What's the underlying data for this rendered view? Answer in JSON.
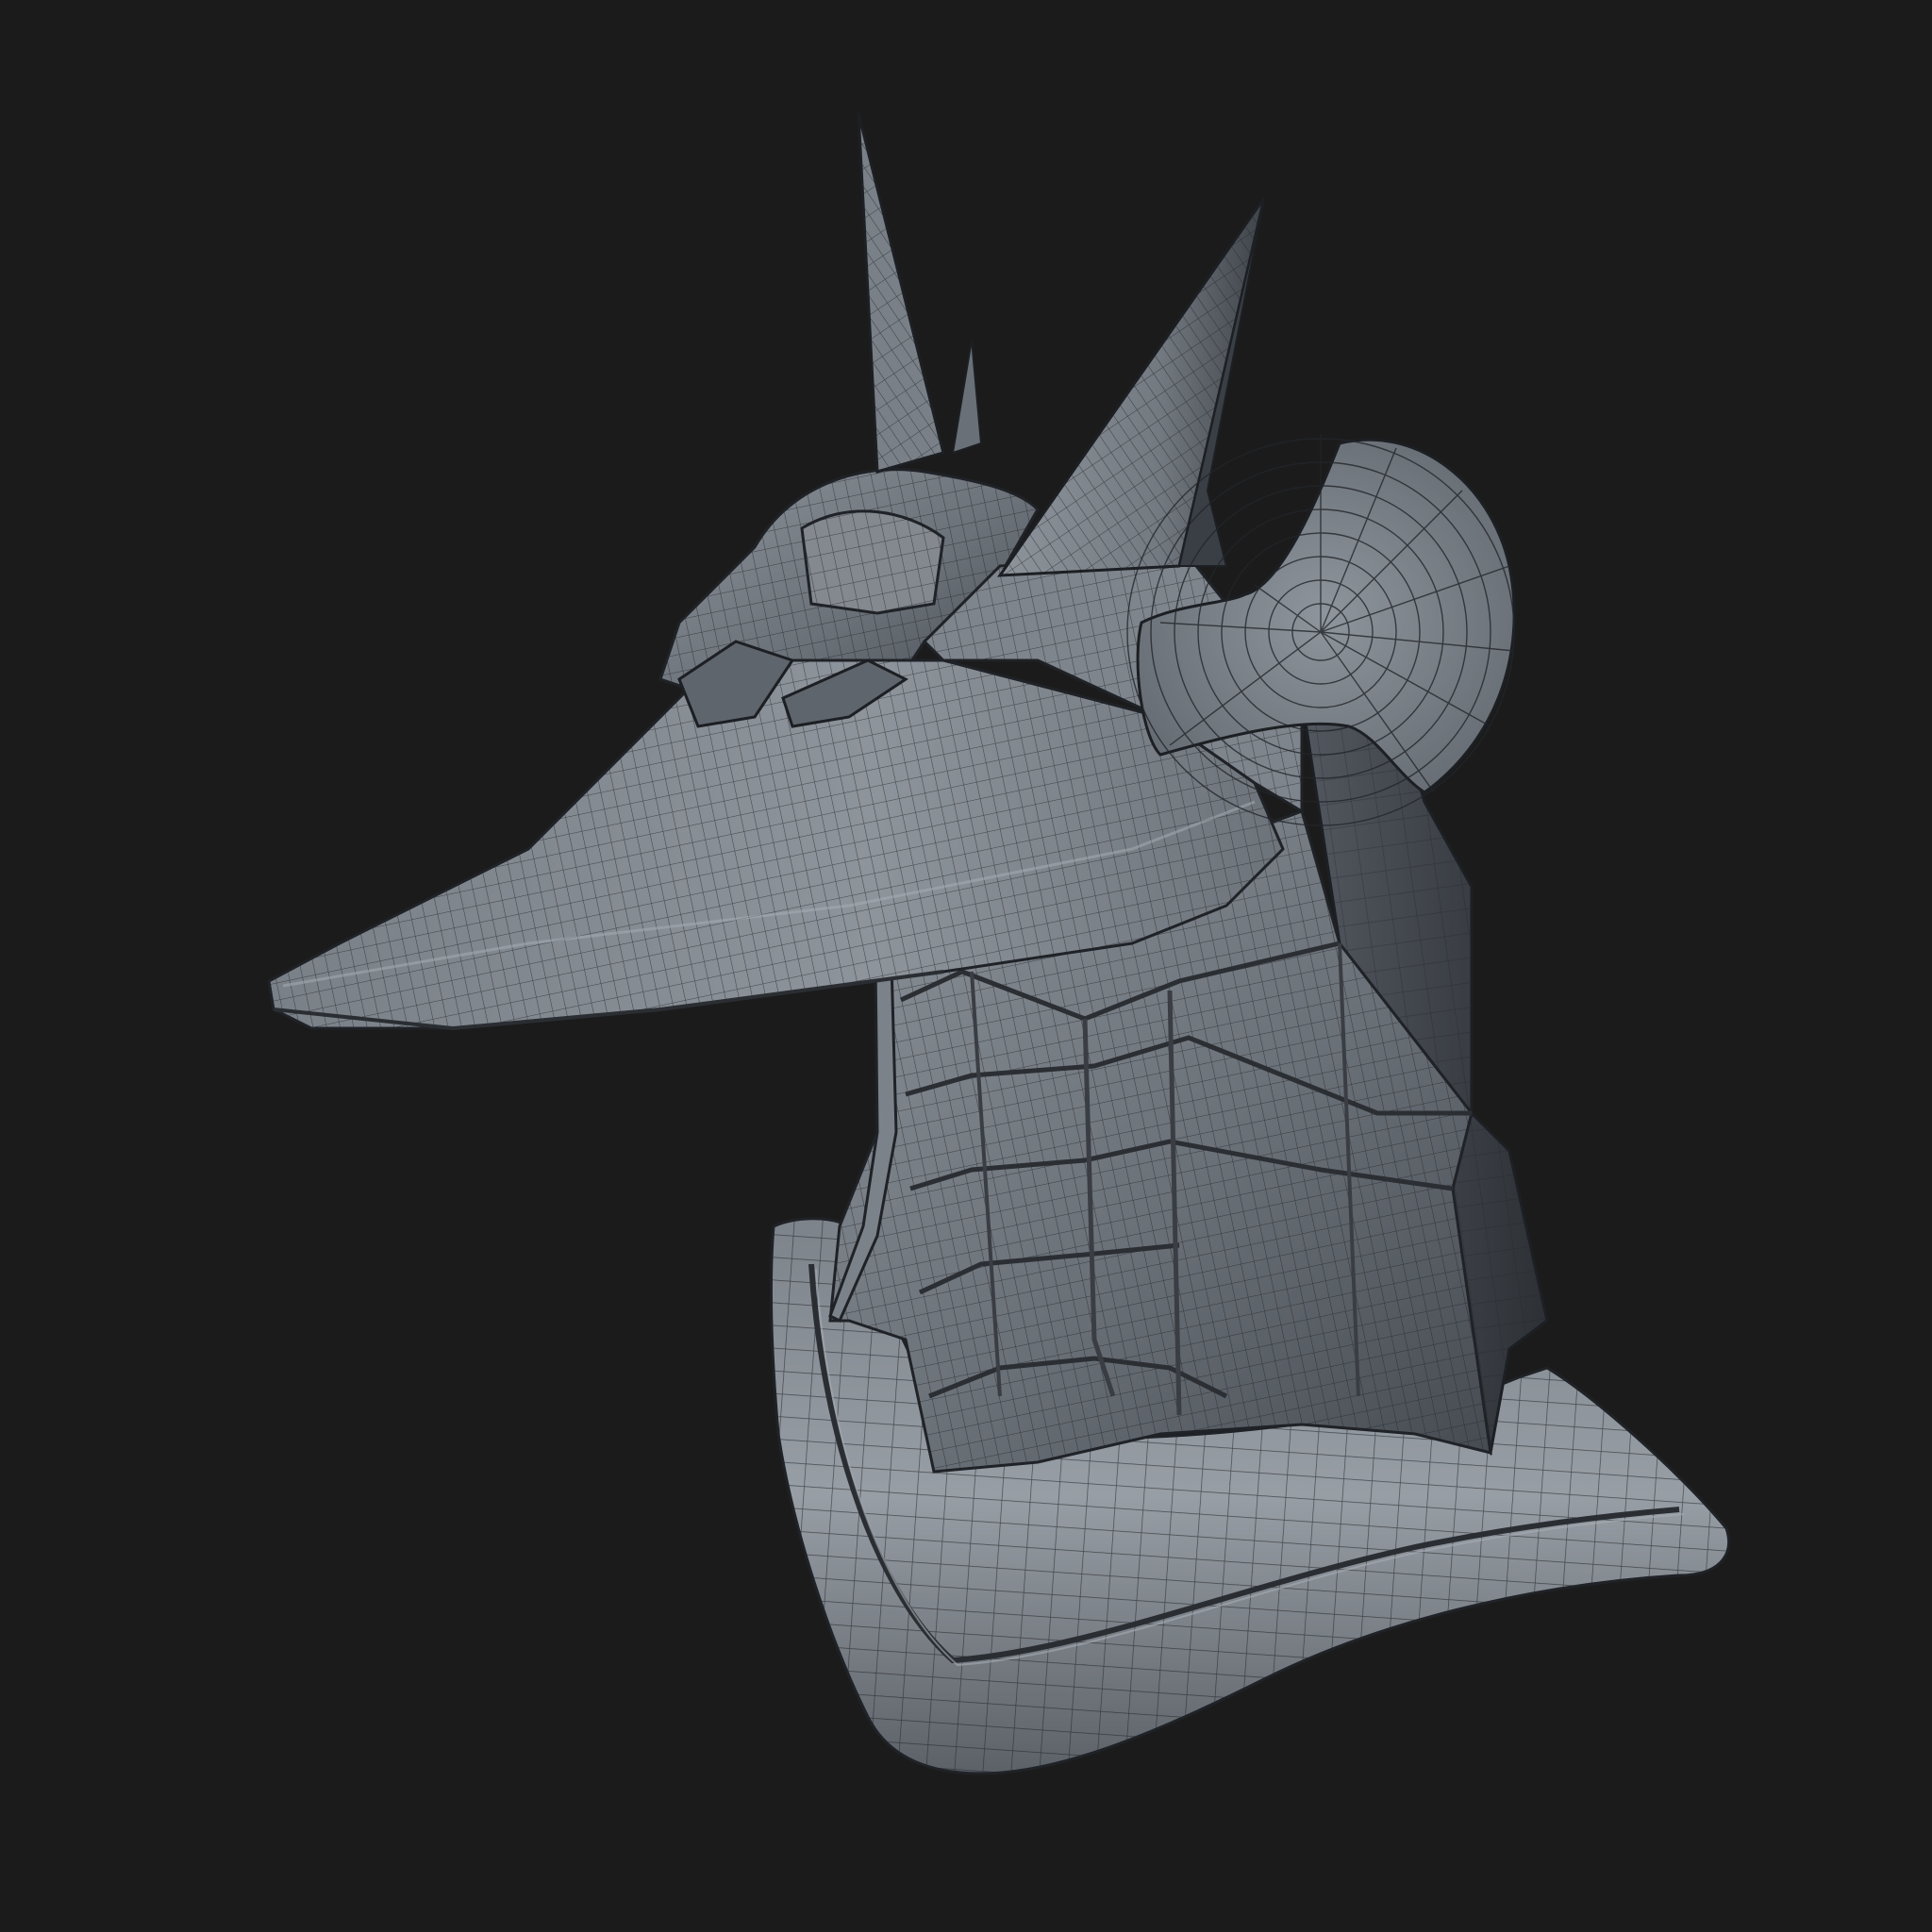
{
  "scene": {
    "background": "#1b1b1b",
    "surface_color": "#6a7179",
    "surface_highlight": "#9aa0a7",
    "surface_shadow": "#2e3238",
    "wire_color": "#22262b",
    "icon": "anubis-helmet-wireframe"
  }
}
